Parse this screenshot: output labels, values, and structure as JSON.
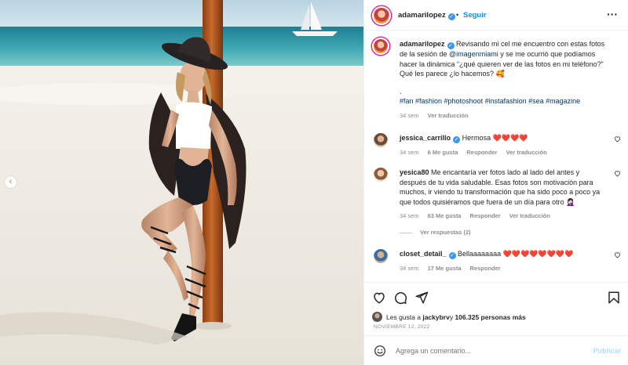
{
  "post": {
    "username": "adamarilopez",
    "follow_label": "Seguir",
    "separator": "•",
    "more_label": "···",
    "prev_arrow": "‹"
  },
  "caption": {
    "username": "adamarilopez",
    "text_before_mention": " Revisando mi cel me encuentro con estas fotos de la sesión de ",
    "mention": "@imagenmiami",
    "text_after_mention": " y se me ocurrió que podíamos hacer la dinámica “¿qué quieren ver de las fotos en mi teléfono?” Qué les parece ¿lo hacemos? 🥰",
    "dot": ".",
    "hashtags": "#fan #fashion #photoshoot #instafashion #sea #magazine",
    "time": "34 sem",
    "translate": "Ver traducción"
  },
  "comments": [
    {
      "username": "jessica_carrillo",
      "verified": true,
      "text": " Hermosa ❤️❤️❤️❤️",
      "time": "34 sem",
      "likes": "6 Me gusta",
      "reply": "Responder",
      "translate": "Ver traducción"
    },
    {
      "username": "yesica80",
      "verified": false,
      "text": " Me encantaría ver fotos lado al lado del antes y después de tu vida saludable. Esas fotos son motivación para muchos, ir viendo tu transformación que ha sido poco a poco ya que todos quisiéramos que fuera de un día para otro 🤦🏻‍♀️",
      "time": "34 sem",
      "likes": "63 Me gusta",
      "reply": "Responder",
      "translate": "Ver traducción",
      "view_replies": "Ver respuestas (2)"
    },
    {
      "username": "closet_detail_",
      "verified": true,
      "text": " Bellaaaaaaaa ❤️❤️❤️❤️❤️❤️❤️❤️",
      "time": "34 sem",
      "likes": "17 Me gusta",
      "reply": "Responder"
    }
  ],
  "actions": {
    "icons": [
      "heart-icon",
      "comment-icon",
      "share-icon",
      "bookmark-icon"
    ]
  },
  "likes_line": {
    "prefix": "Les gusta a ",
    "user": "jackybrv",
    "middle": " y ",
    "count": "106.325 personas más"
  },
  "date": "NOVIEMBRE 12, 2022",
  "add_comment": {
    "placeholder": "Agrega un comentario...",
    "publish": "Publicar"
  },
  "colors": {
    "accent": "#0095f6",
    "verified": "#3897f0",
    "muted": "#8e8e8e",
    "publish_disabled": "#b2dffc"
  }
}
